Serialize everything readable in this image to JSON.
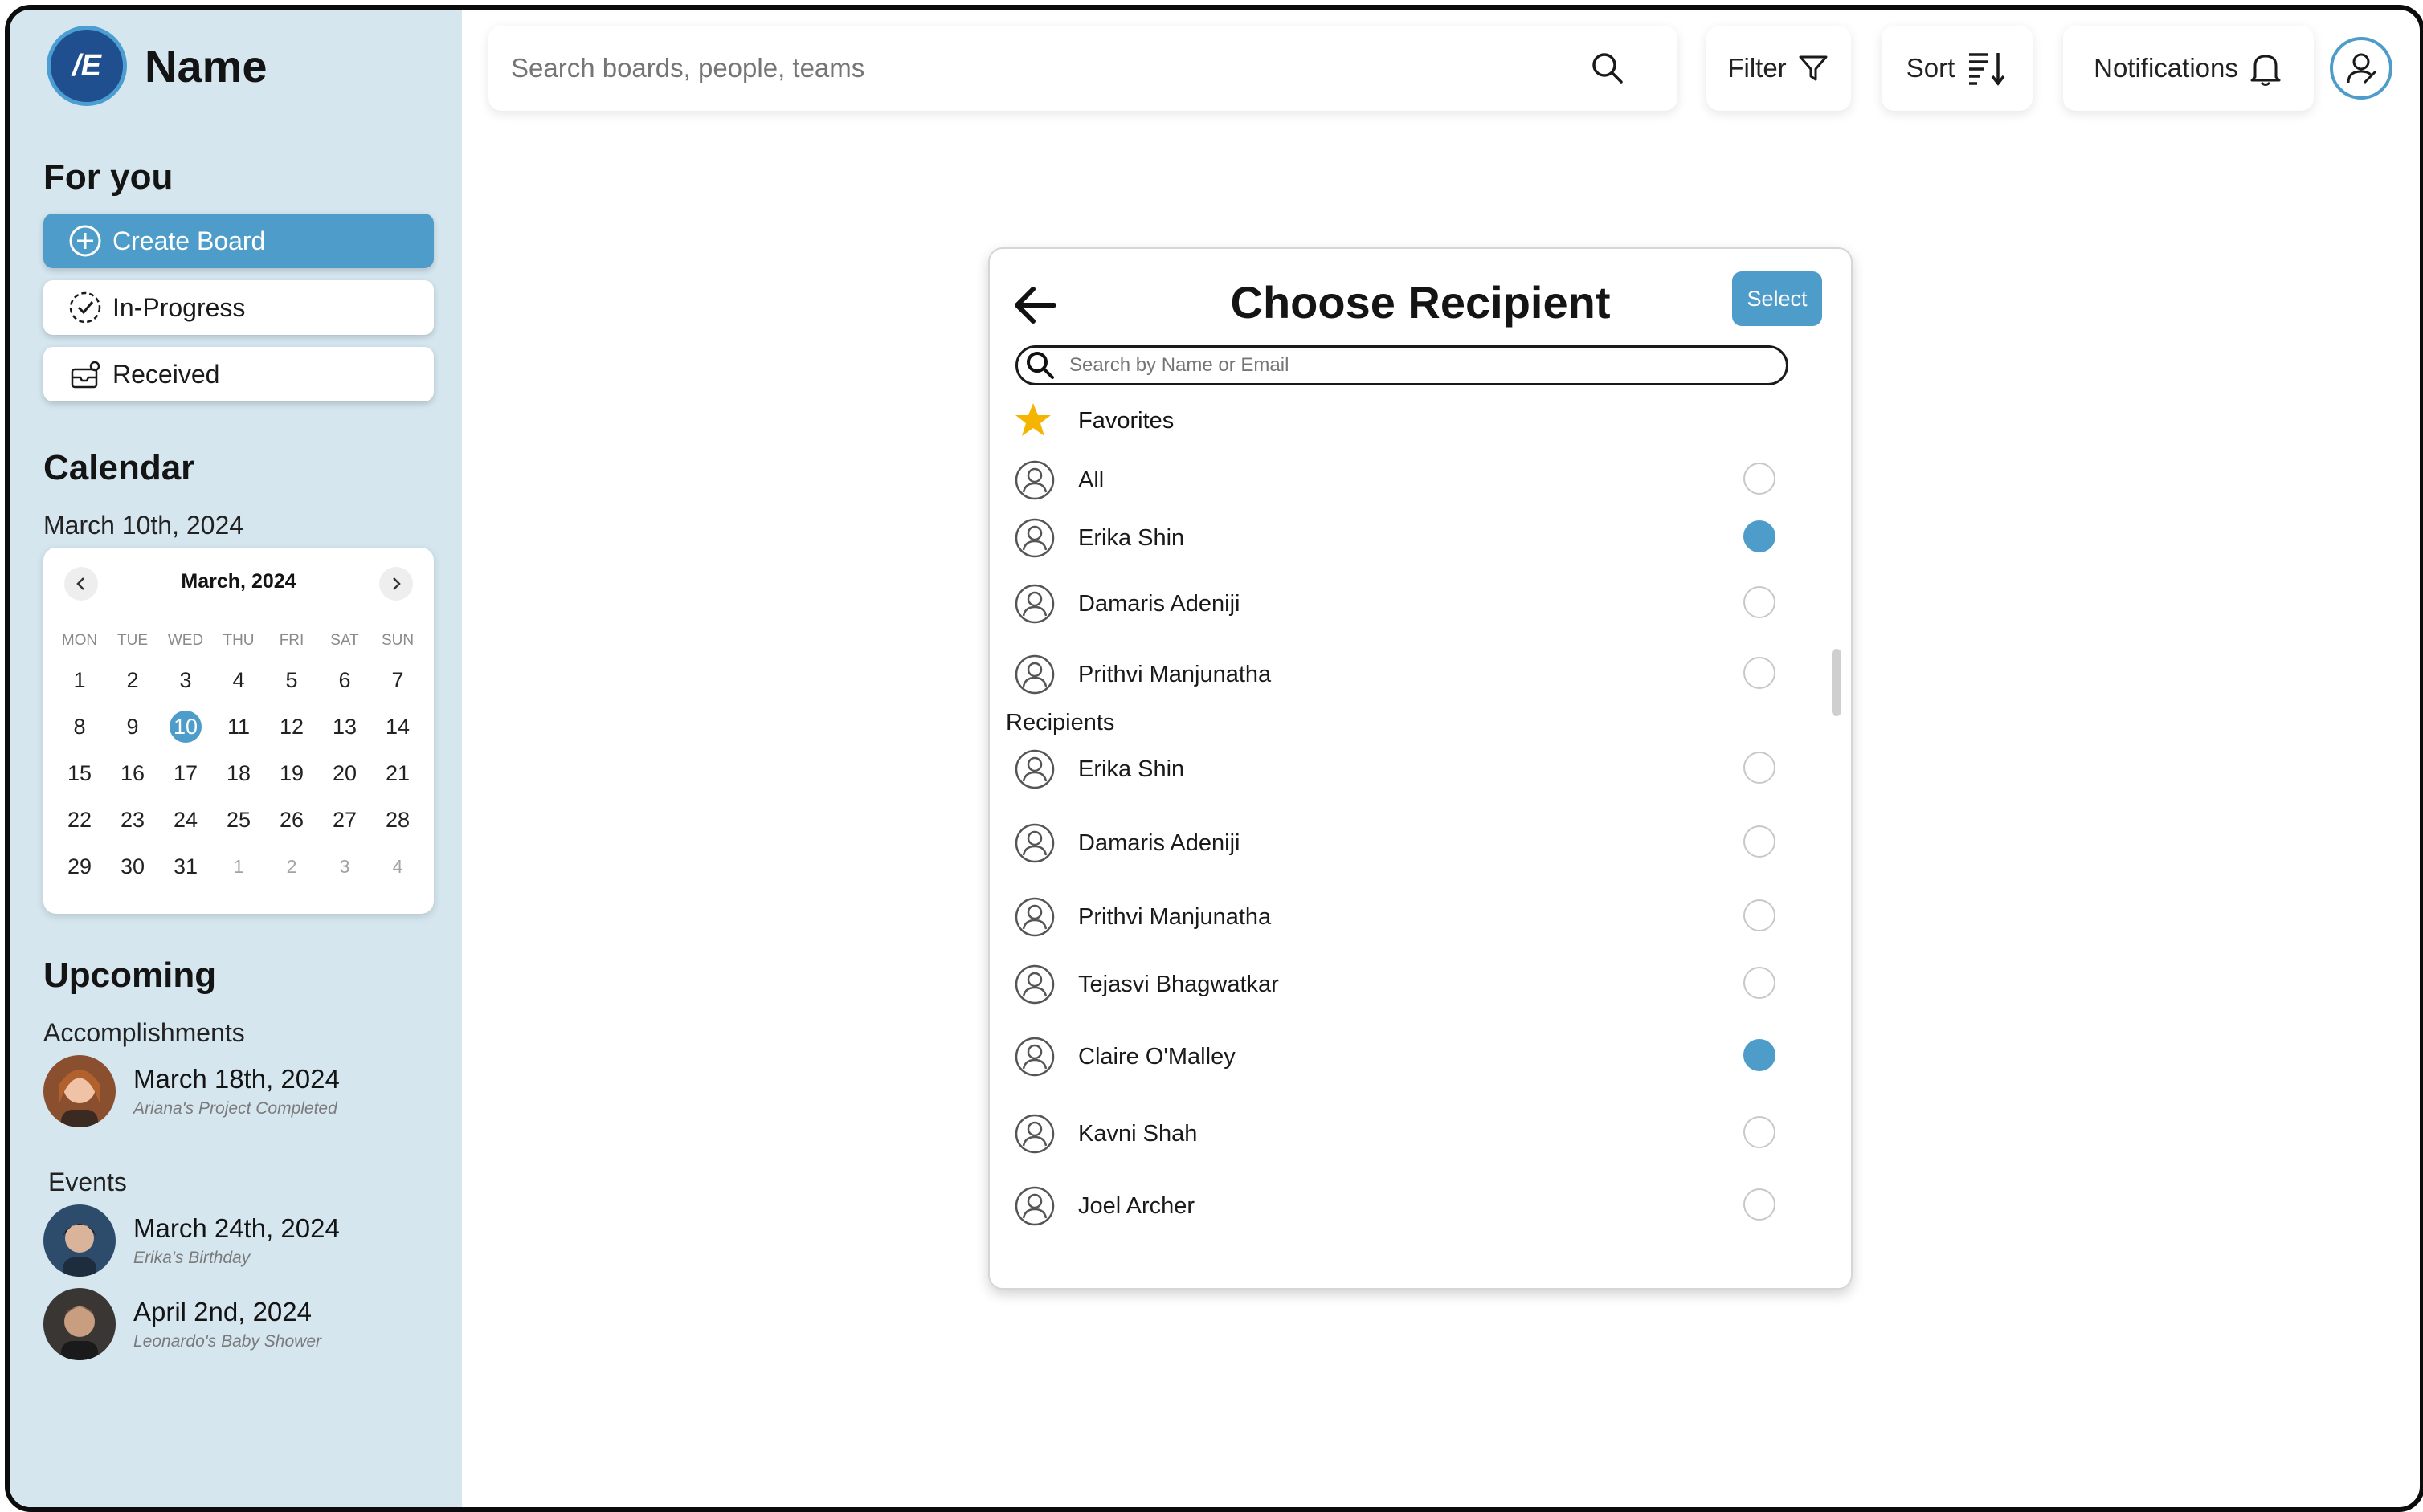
{
  "app": {
    "name": "Name",
    "logo_text": "/E"
  },
  "sidebar": {
    "for_you_title": "For you",
    "buttons": [
      {
        "label": "Create Board",
        "icon": "plus-circle-icon"
      },
      {
        "label": "In-Progress",
        "icon": "progress-check-icon"
      },
      {
        "label": "Received",
        "icon": "received-inbox-icon"
      }
    ],
    "calendar_title": "Calendar",
    "current_date": "March 10th, 2024",
    "calendar": {
      "month_label": "March, 2024",
      "weekdays": [
        "MON",
        "TUE",
        "WED",
        "THU",
        "FRI",
        "SAT",
        "SUN"
      ],
      "weeks": [
        [
          "1",
          "2",
          "3",
          "4",
          "5",
          "6",
          "7"
        ],
        [
          "8",
          "9",
          "10",
          "11",
          "12",
          "13",
          "14"
        ],
        [
          "15",
          "16",
          "17",
          "18",
          "19",
          "20",
          "21"
        ],
        [
          "22",
          "23",
          "24",
          "25",
          "26",
          "27",
          "28"
        ],
        [
          "29",
          "30",
          "31",
          "1",
          "2",
          "3",
          "4"
        ]
      ],
      "selected_day": "10"
    },
    "upcoming_title": "Upcoming",
    "accomplishments_label": "Accomplishments",
    "accomplishments": [
      {
        "date": "March 18th, 2024",
        "description": "Ariana's Project Completed"
      }
    ],
    "events_label": "Events",
    "events": [
      {
        "date": "March 24th, 2024",
        "description": "Erika's Birthday"
      },
      {
        "date": "April 2nd, 2024",
        "description": "Leonardo's Baby Shower"
      }
    ]
  },
  "topbar": {
    "search_placeholder": "Search boards, people, teams",
    "filter_label": "Filter",
    "sort_label": "Sort",
    "notifications_label": "Notifications"
  },
  "modal": {
    "title": "Choose Recipient",
    "select_label": "Select",
    "search_placeholder": "Search by Name or Email",
    "favorites_label": "Favorites",
    "favorites": [
      {
        "name": "All",
        "selected": false
      },
      {
        "name": "Erika Shin",
        "selected": true
      },
      {
        "name": "Damaris Adeniji",
        "selected": false
      },
      {
        "name": "Prithvi Manjunatha",
        "selected": false
      }
    ],
    "recipients_label": "Recipients",
    "recipients": [
      {
        "name": "Erika Shin",
        "selected": false
      },
      {
        "name": "Damaris Adeniji",
        "selected": false
      },
      {
        "name": "Prithvi Manjunatha",
        "selected": false
      },
      {
        "name": "Tejasvi Bhagwatkar",
        "selected": false
      },
      {
        "name": "Claire O'Malley",
        "selected": true
      },
      {
        "name": "Kavni Shah",
        "selected": false
      },
      {
        "name": "Joel Archer",
        "selected": false
      }
    ]
  },
  "colors": {
    "sidebar_bg": "#d5e6ef",
    "accent": "#4d9cc9",
    "logo_bg": "#1f4f8e",
    "star": "#f5b400"
  }
}
